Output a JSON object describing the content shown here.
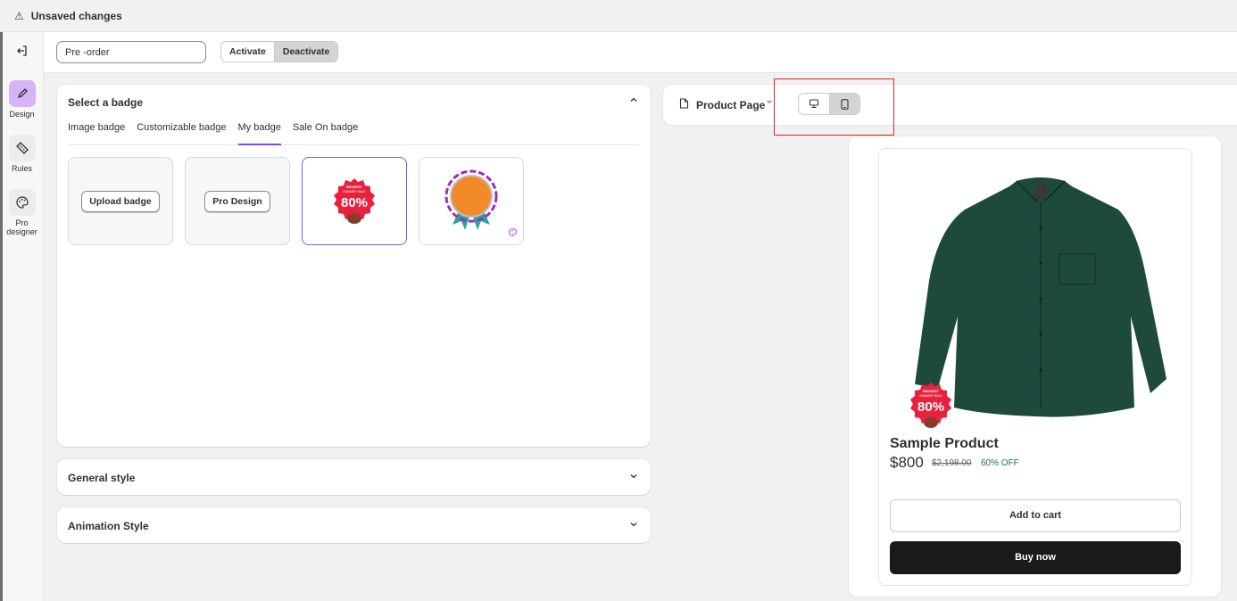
{
  "topbar": {
    "warn_icon": "⚠",
    "title": "Unsaved changes"
  },
  "rail": {
    "exit_icon": "exit-icon",
    "items": [
      {
        "label": "Design",
        "icon": "pencil-icon",
        "active": true
      },
      {
        "label": "Rules",
        "icon": "ruler-icon",
        "active": false
      },
      {
        "label": "Pro designer",
        "icon": "palette-icon",
        "active": false
      }
    ]
  },
  "toolbar": {
    "name_value": "Pre -order",
    "activate_label": "Activate",
    "deactivate_label": "Deactivate",
    "selected": "Deactivate"
  },
  "badge_panel": {
    "title": "Select a badge",
    "tabs": [
      {
        "label": "Image badge"
      },
      {
        "label": "Customizable badge"
      },
      {
        "label": "My badge",
        "active": true
      },
      {
        "label": "Sale On badge"
      }
    ],
    "tiles": {
      "upload_label": "Upload badge",
      "pro_design_label": "Pro Design"
    },
    "sale_badge": {
      "top_line": "BIGGEST",
      "sub_line": "SUMMER SALE",
      "percent": "80%"
    }
  },
  "sections": {
    "general": "General style",
    "animation": "Animation Style"
  },
  "preview": {
    "page_label": "Product Page",
    "device_selected": "mobile",
    "product": {
      "name": "Sample Product",
      "price": "$800",
      "compare_price": "$2,198.00",
      "discount": "60% OFF",
      "add_to_cart": "Add to cart",
      "buy_now": "Buy now"
    }
  },
  "colors": {
    "accent": "#8a3ffc",
    "design_active_bg": "#d7b4f8",
    "shirt": "#1e4a3e",
    "badge_red": "#e8213f",
    "badge_orange": "#f28a2a",
    "highlight_box": "#e02424"
  }
}
